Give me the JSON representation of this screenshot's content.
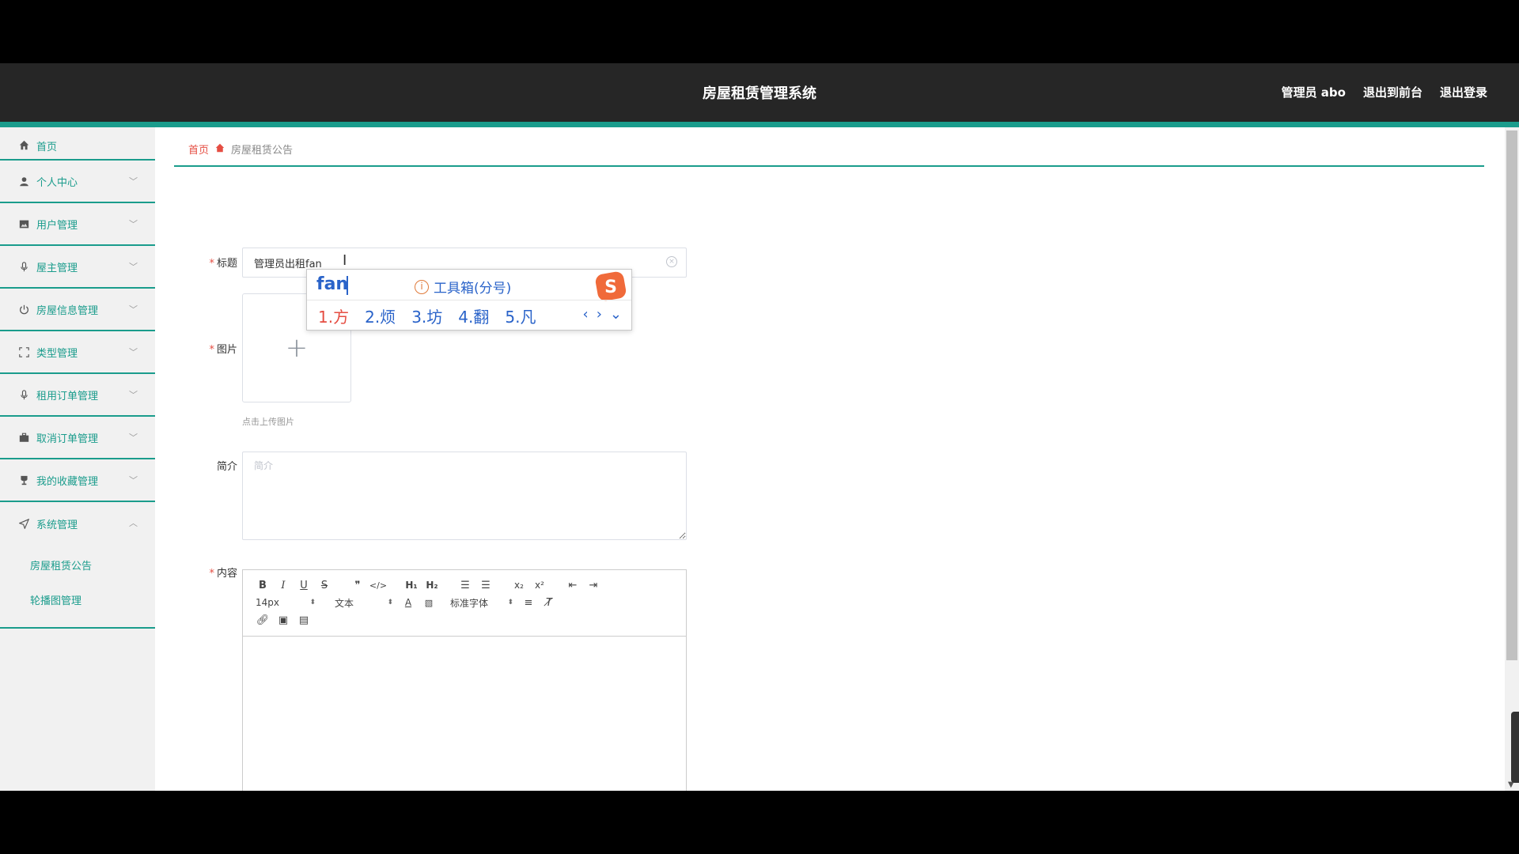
{
  "header": {
    "title": "房屋租赁管理系统",
    "admin_label": "管理员 abo",
    "back_front_label": "退出到前台",
    "logout_label": "退出登录"
  },
  "sidebar": {
    "home_label": "首页",
    "items": [
      {
        "label": "个人中心",
        "icon": "user-icon"
      },
      {
        "label": "用户管理",
        "icon": "image-icon"
      },
      {
        "label": "屋主管理",
        "icon": "microphone-icon"
      },
      {
        "label": "房屋信息管理",
        "icon": "power-icon"
      },
      {
        "label": "类型管理",
        "icon": "fullscreen-icon"
      },
      {
        "label": "租用订单管理",
        "icon": "microphone-icon"
      },
      {
        "label": "取消订单管理",
        "icon": "briefcase-icon"
      },
      {
        "label": "我的收藏管理",
        "icon": "trophy-icon"
      },
      {
        "label": "系统管理",
        "icon": "send-icon"
      }
    ],
    "sub_items": [
      "房屋租赁公告",
      "轮播图管理"
    ]
  },
  "breadcrumb": {
    "home": "首页",
    "current": "房屋租赁公告"
  },
  "form": {
    "title_label": "标题",
    "title_value": "管理员出租fan",
    "image_label": "图片",
    "upload_hint": "点击上传图片",
    "intro_label": "简介",
    "intro_placeholder": "简介",
    "content_label": "内容"
  },
  "editor": {
    "font_size": "14px",
    "block_format": "文本",
    "font_family": "标准字体"
  },
  "ime": {
    "pinyin": "fan",
    "toolbox": "工具箱(分号)",
    "candidates": [
      "1.方",
      "2.烦",
      "3.坊",
      "4.翻",
      "5.凡"
    ]
  },
  "colors": {
    "accent": "#1a9c8c",
    "header_bg": "#262626",
    "breadcrumb_red": "#e54d42"
  }
}
